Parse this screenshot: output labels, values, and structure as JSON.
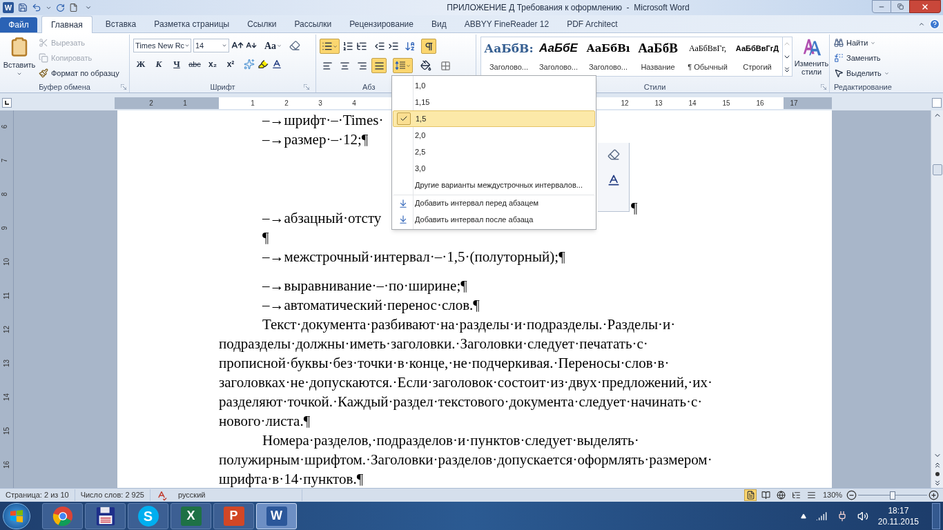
{
  "window": {
    "title": "ПРИЛОЖЕНИЕ Д Требования к оформлению  -  Microsoft Word",
    "app_glyph": "W"
  },
  "tabs": [
    {
      "label": "Файл",
      "kind": "file",
      "selected": false
    },
    {
      "label": "Главная",
      "kind": "tab",
      "selected": true
    },
    {
      "label": "Вставка",
      "kind": "tab",
      "selected": false
    },
    {
      "label": "Разметка страницы",
      "kind": "tab",
      "selected": false
    },
    {
      "label": "Ссылки",
      "kind": "tab",
      "selected": false
    },
    {
      "label": "Рассылки",
      "kind": "tab",
      "selected": false
    },
    {
      "label": "Рецензирование",
      "kind": "tab",
      "selected": false
    },
    {
      "label": "Вид",
      "kind": "tab",
      "selected": false
    },
    {
      "label": "ABBYY FineReader 12",
      "kind": "tab",
      "selected": false
    },
    {
      "label": "PDF Architect",
      "kind": "tab",
      "selected": false
    }
  ],
  "clipboard": {
    "paste": "Вставить",
    "cut": {
      "label": "Вырезать",
      "disabled": true
    },
    "copy": {
      "label": "Копировать",
      "disabled": true
    },
    "format_painter": {
      "label": "Формат по образцу",
      "disabled": false
    },
    "label": "Буфер обмена"
  },
  "font": {
    "font_name": "Times New Rc",
    "font_size": "14",
    "change_case": "Aa",
    "bold": "Ж",
    "italic": "К",
    "underline": "Ч",
    "strikethrough": "abc",
    "subscript": "x₂",
    "superscript": "x²",
    "label": "Шрифт"
  },
  "paragraph": {
    "bullets_active": true,
    "show_marks_active": true,
    "line_spacing_open": true,
    "alignment": [
      {
        "kind": "left",
        "selected": false
      },
      {
        "kind": "center",
        "selected": false
      },
      {
        "kind": "right",
        "selected": false
      },
      {
        "kind": "justify",
        "selected": true
      }
    ],
    "label": "Абз"
  },
  "styles": {
    "items": [
      {
        "preview": "АаБбВ:",
        "name": "Заголово...",
        "kind": "heading1"
      },
      {
        "preview": "АаБбЕ",
        "name": "Заголово...",
        "kind": "heading2"
      },
      {
        "preview": "АаБбВı",
        "name": "Заголово...",
        "kind": "heading3"
      },
      {
        "preview": "АаБбВ",
        "name": "Название",
        "kind": "title"
      },
      {
        "preview": "АаБбВвГг,",
        "name": "¶ Обычный",
        "kind": "normal"
      },
      {
        "preview": "АаБбВвГгД",
        "name": "Строгий",
        "kind": "strong"
      }
    ],
    "change_styles": "Изменить стили",
    "label": "Стили"
  },
  "editing": {
    "find": "Найти",
    "replace": "Заменить",
    "select": "Выделить",
    "label": "Редактирование"
  },
  "ruler": {
    "numbers": [
      "2",
      "1",
      "1",
      "2",
      "3",
      "4",
      "12",
      "13",
      "14",
      "15",
      "16",
      "17"
    ],
    "vertical_numbers": [
      "6",
      "7",
      "8",
      "9",
      "10",
      "11",
      "12",
      "13",
      "14",
      "15",
      "16"
    ]
  },
  "document": {
    "list_top": [
      "–→шрифт·–·Times·",
      "–→размер·–·12;¶"
    ],
    "list_middle": [
      "–→абзацный·отсту",
      "¶",
      "–→межстрочный·интервал·–·1,5·(полуторный);¶",
      "–→выравнивание·–·по·ширине;¶",
      "–→автоматический·перенос·слов.¶"
    ],
    "paragraphs": [
      [
        "Текст·документа·разбивают·на·разделы·и·подразделы.·Разделы·и·",
        "подразделы·должны·иметь·заголовки.·Заголовки·следует·печатать·с·",
        "прописной·буквы·без·точки·в·конце,·не·подчеркивая.·Переносы·слов·в·",
        "заголовках·не·допускаются.·Если·заголовок·состоит·из·двух·предложений,·их·",
        "разделяют·точкой.·Каждый·раздел·текстового·документа·следует·начинать·с·",
        "нового·листа.¶"
      ],
      [
        "Номера·разделов,·подразделов·и·пунктов·следует·выделять·",
        "полужирным·шрифтом.·Заголовки·разделов·допускается·оформлять·размером·",
        "шрифта·в·14·пунктов.¶"
      ]
    ],
    "stray_mark": "¶"
  },
  "line_spacing_menu": {
    "items": [
      {
        "label": "1,0",
        "kind": "value",
        "selected": false
      },
      {
        "label": "1,15",
        "kind": "value",
        "selected": false
      },
      {
        "label": "1,5",
        "kind": "value",
        "selected": true
      },
      {
        "label": "2,0",
        "kind": "value",
        "selected": false
      },
      {
        "label": "2,5",
        "kind": "value",
        "selected": false
      },
      {
        "label": "3,0",
        "kind": "value",
        "selected": false
      },
      {
        "label": "Другие варианты междустрочных интервалов...",
        "kind": "more",
        "selected": false
      },
      {
        "label": "Добавить интервал перед абзацем",
        "kind": "before",
        "selected": false
      },
      {
        "label": "Добавить интервал после абзаца",
        "kind": "after",
        "selected": false
      }
    ]
  },
  "status_bar": {
    "page": "Страница: 2 из 10",
    "words": "Число слов: 2 925",
    "language": "русский",
    "views": [
      {
        "kind": "print",
        "selected": true
      },
      {
        "kind": "reading",
        "selected": false
      },
      {
        "kind": "web",
        "selected": false
      },
      {
        "kind": "outline",
        "selected": false
      },
      {
        "kind": "draft",
        "selected": false
      }
    ],
    "zoom": "130%",
    "zoom_slider": {
      "level": 0.5
    }
  },
  "taskbar": {
    "apps": [
      {
        "kind": "chrome",
        "active": false
      },
      {
        "kind": "floppy",
        "active": false
      },
      {
        "kind": "skype",
        "glyph": "S",
        "active": false
      },
      {
        "kind": "excel",
        "glyph": "X",
        "active": false
      },
      {
        "kind": "powerpoint",
        "glyph": "P",
        "active": false
      },
      {
        "kind": "word",
        "glyph": "W",
        "active": true
      }
    ],
    "time": "18:17",
    "date": "20.11.2015"
  }
}
